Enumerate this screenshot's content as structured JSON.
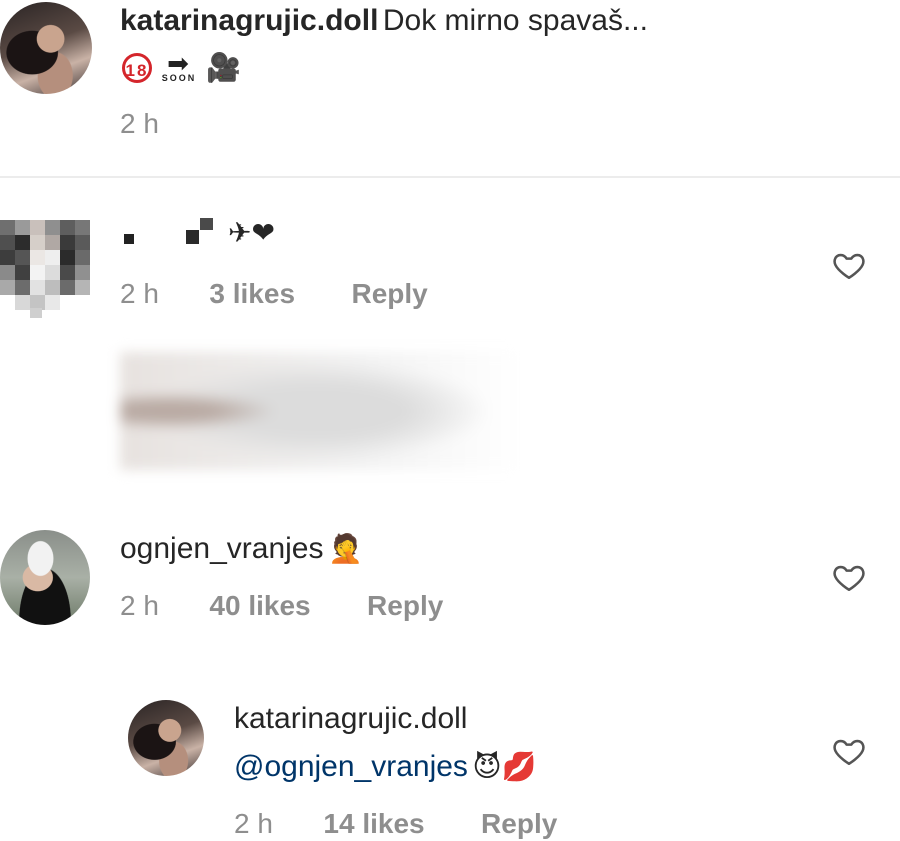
{
  "post": {
    "username": "katarinagrujic.doll",
    "caption": "Dok mirno spavaš...",
    "caption_emojis": "🔞➡🎥",
    "time": "2 h"
  },
  "comments": [
    {
      "username_hidden": true,
      "text_emojis": "✈❤",
      "time": "2 h",
      "likes": "3 likes",
      "reply": "Reply"
    },
    {
      "username": "ognjen_vranjes",
      "text_emojis": "🤦",
      "time": "2 h",
      "likes": "40 likes",
      "reply": "Reply"
    },
    {
      "username": "katarinagrujic.doll",
      "mention": "@ognjen_vranjes",
      "text_emojis": "😈💋",
      "time": "2 h",
      "likes": "14 likes",
      "reply": "Reply"
    }
  ],
  "icons": {
    "like": "heart-outline-icon"
  },
  "colors": {
    "text": "#262626",
    "muted": "#8e8e8e",
    "mention": "#003569",
    "divider": "#ececec"
  }
}
